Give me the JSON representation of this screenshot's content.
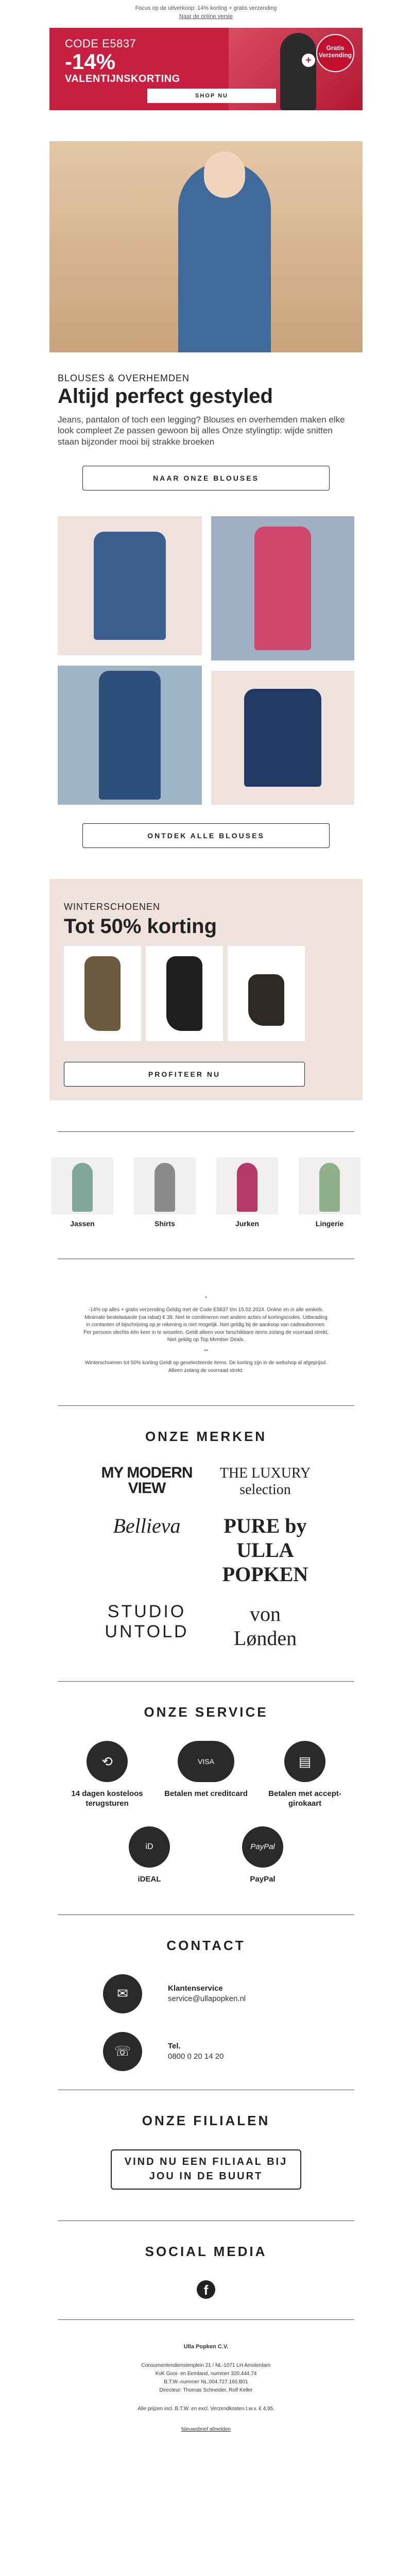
{
  "preheader": "Focus op de uitverkoop: 14% korting + gratis verzending",
  "online_link": "Naar de online versie",
  "promo": {
    "code": "CODE E5837",
    "percent": "-14%",
    "title": "VALENTIJNSKORTING",
    "badge": "Gratis Verzending",
    "plus": "+",
    "button": "SHOP NU",
    "color": "#c71f3f"
  },
  "blouses": {
    "kicker": "BLOUSES & OVERHEMDEN",
    "title": "Altijd perfect gestyled",
    "text": "Jeans, pantalon of toch een legging? Blouses en overhemden maken elke look compleet Ze passen gewoon bij alles Onze stylingtip: wijde snitten staan bijzonder mooi bij strakke broeken",
    "button1": "NAAR ONZE BLOUSES",
    "button2": "ONTDEK ALLE BLOUSES"
  },
  "winter": {
    "kicker": "WINTERSCHOENEN",
    "title": "Tot 50% korting",
    "button": "PROFITEER NU"
  },
  "categories": [
    {
      "label": "Jassen"
    },
    {
      "label": "Shirts"
    },
    {
      "label": "Jurken"
    },
    {
      "label": "Lingerie"
    }
  ],
  "fine_print": [
    "*",
    "-14% op alles + gratis verzending Geldig met de Code E5837 t/m 15.02.2024. Online en in alle winkels. Minimale bestelwaarde (na rabat) € 39. Niet te combineren met andere acties of kortingscodes. Uitbeading in contanten of bijschrijving op je rekening is niet mogelijk. Niet geldig bij de aankoop van cadeaubonnen. Per persoon slechts één keer in te wisselen. Geldt alleen voor beschikbare items zolang de voorraad strekt. Niet geldig op Top Member Deals.",
    "**",
    "Winterschoenen tot 50% korting Geldt op geselecteerde items. De korting zijn in de webshop al afgeprijsd. Alleen zolang de voorraad strekt."
  ],
  "brands": {
    "heading": "ONZE MERKEN",
    "list": [
      "MY MODERN VIEW",
      "THE LUXURY selection",
      "Bellieva",
      "PURE by ULLA POPKEN",
      "STUDIO UNTOLD",
      "von Lønden"
    ]
  },
  "service": {
    "heading": "ONZE SERVICE",
    "items": [
      {
        "label": "14 dagen kosteloos terugsturen",
        "icon": "return-box-icon"
      },
      {
        "label": "Betalen met creditcard",
        "icon": "creditcard-icon"
      },
      {
        "label": "Betalen met accept-girokaart",
        "icon": "invoice-icon"
      },
      {
        "label": "iDEAL",
        "icon": "ideal-icon"
      },
      {
        "label": "PayPal",
        "icon": "paypal-icon"
      }
    ]
  },
  "contact": {
    "heading": "CONTACT",
    "mail_title": "Klantenservice",
    "mail_value": "service@ullapopken.nl",
    "phone_title": "Tel.",
    "phone_value": "0800 0 20 14 20"
  },
  "stores": {
    "heading": "ONZE FILIALEN",
    "button": "VIND NU EEN FILIAAL BIJ JOU IN DE BUURT"
  },
  "social": {
    "heading": "SOCIAL MEDIA",
    "fb": "f"
  },
  "footer": {
    "company": "Ulla Popken C.V.",
    "address": "Consumentendienstenplein 21 / NL-1071 LH Amsterdam",
    "kvk": "KvK Gooi- en Eemland, nummer 320.444.74",
    "btw": "B.T.W.-nummer NL.004.727.160.B01",
    "directors": "Directeur: Thomas Schneider, Rolf Keller",
    "prices": "Alle prijzen incl. B.T.W. en excl. Verzendkosten t.w.v. € 4,95.",
    "unsubscribe": "Nieuwsbrief afmelden"
  }
}
